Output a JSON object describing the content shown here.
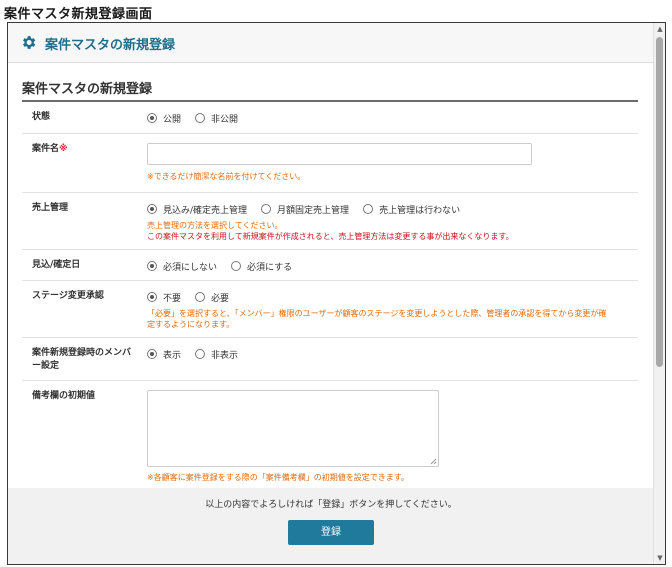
{
  "page": {
    "title": "案件マスタ新規登録画面"
  },
  "header": {
    "title": "案件マスタの新規登録",
    "icon": "gear-icon",
    "accent_color": "#1f6f8b"
  },
  "section": {
    "title": "案件マスタの新規登録"
  },
  "form": {
    "status": {
      "label": "状態",
      "options": [
        "公開",
        "非公開"
      ],
      "selected": "公開"
    },
    "case_name": {
      "label": "案件名",
      "required_mark": "※",
      "value": "",
      "hint": "※できるだけ簡潔な名前を付けてください。"
    },
    "sales_management": {
      "label": "売上管理",
      "options": [
        "見込み/確定売上管理",
        "月額固定売上管理",
        "売上管理は行わない"
      ],
      "selected": "見込み/確定売上管理",
      "hint": "売上管理の方法を選択してください。",
      "warning": "この案件マスタを利用して新規案件が作成されると、売上管理方法は変更する事が出来なくなります。"
    },
    "expected_date": {
      "label": "見込/確定日",
      "options": [
        "必須にしない",
        "必須にする"
      ],
      "selected": "必須にしない"
    },
    "stage_approval": {
      "label": "ステージ変更承認",
      "options": [
        "不要",
        "必要"
      ],
      "selected": "不要",
      "hint_line1": "「必要」を選択すると、「メンバー」権限のユーザーが顧客のステージを変更しようとした際、管理者の承認を得てから変更が確",
      "hint_line2": "定するようになります。"
    },
    "new_registration_menu": {
      "label": "案件新規登録時のメンバー設定",
      "options": [
        "表示",
        "非表示"
      ],
      "selected": "表示"
    },
    "remarks_default": {
      "label": "備考欄の初期値",
      "value": "",
      "hint": "※各顧客に案件登録をする際の「案件備考欄」の初期値を設定できます。"
    }
  },
  "footer": {
    "instruction": "以上の内容でよろしければ「登録」ボタンを押してください。",
    "submit_label": "登録",
    "submit_color": "#1f7a9c"
  }
}
